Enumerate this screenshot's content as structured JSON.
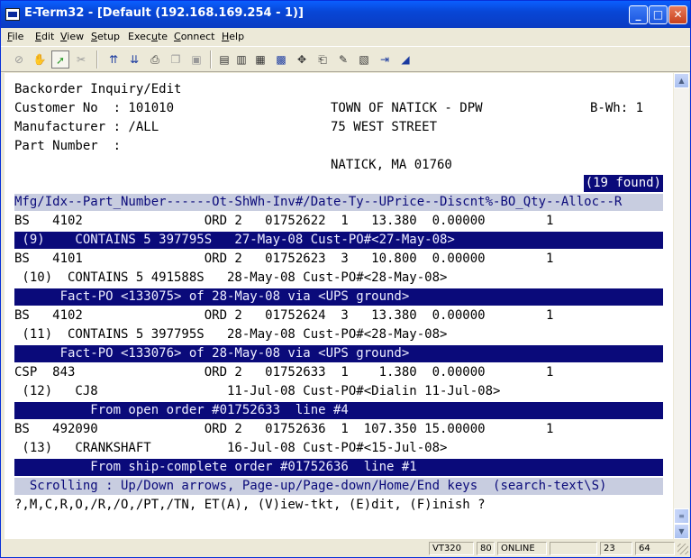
{
  "window": {
    "title": "E-Term32 - [Default (192.168.169.254 - 1)]"
  },
  "menu": [
    {
      "label": "File",
      "key": "F",
      "rest": "ile"
    },
    {
      "label": "Edit",
      "key": "E",
      "rest": "dit"
    },
    {
      "label": "View",
      "key": "V",
      "rest": "iew"
    },
    {
      "label": "Setup",
      "key": "S",
      "rest": "etup"
    },
    {
      "label": "Execute",
      "pre": "Exec",
      "key": "u",
      "rest": "te"
    },
    {
      "label": "Connect",
      "key": "C",
      "rest": "onnect"
    },
    {
      "label": "Help",
      "key": "H",
      "rest": "elp"
    }
  ],
  "toolbar_icons": [
    "stop-icon",
    "hand-icon",
    "connect-icon",
    "disconnect-icon",
    "send-icon",
    "receive-icon",
    "print-icon",
    "copy-icon",
    "paste-icon",
    "script-icon",
    "log-icon",
    "capture-icon",
    "keyboard-icon",
    "move-icon",
    "printer-icon",
    "notepad-icon",
    "calculator-icon",
    "exit-icon",
    "draw-icon"
  ],
  "terminal": {
    "line1": "Backorder Inquiry/Edit",
    "line2_left": "Customer No  : 101010",
    "line2_mid": "TOWN OF NATICK - DPW",
    "line2_right": "B-Wh: 1",
    "line3_left": "Manufacturer : /ALL",
    "line3_mid": "75 WEST STREET",
    "line4_left": "Part Number  :",
    "line5_mid": "NATICK, MA 01760",
    "found": "(19 found)",
    "header": "Mfg/Idx--Part_Number------Ot-ShWh-Inv#/Date-Ty--UPrice--Discnt%-BO_Qty--Alloc--R",
    "rows": [
      "BS   4102                ORD 2   01752622  1   13.380  0.00000        1",
      "BS   4101                ORD 2   01752623  3   10.800  0.00000        1",
      " (10)  CONTAINS 5 491588S   28-May-08 Cust-PO#<28-May-08>",
      "BS   4102                ORD 2   01752624  3   13.380  0.00000        1",
      " (11)  CONTAINS 5 397795S   28-May-08 Cust-PO#<28-May-08>",
      "CSP  843                 ORD 2   01752633  1    1.380  0.00000        1",
      " (12)   CJ8                 11-Jul-08 Cust-PO#<Dialin 11-Jul-08>",
      "BS   492090              ORD 2   01752636  1  107.350 15.00000        1",
      " (13)   CRANKSHAFT          16-Jul-08 Cust-PO#<15-Jul-08>"
    ],
    "bars": [
      " (9)    CONTAINS 5 397795S   27-May-08 Cust-PO#<27-May-08>",
      "      Fact-PO <133075> of 28-May-08 via <UPS ground>",
      "      Fact-PO <133076> of 28-May-08 via <UPS ground>",
      "          From open order #01752633  line #4",
      "          From ship-complete order #01752636  line #1"
    ],
    "scroll_msg": "  Scrolling : Up/Down arrows, Page-up/Page-down/Home/End keys  (search-text\\S)",
    "prompt": "?,M,C,R,O,/R,/O,/PT,/TN, ET(A), (V)iew-tkt, (E)dit, (F)inish ?"
  },
  "status": {
    "emulation": "VT320",
    "cols": "80",
    "state": "ONLINE",
    "row": "23",
    "col": "64"
  }
}
